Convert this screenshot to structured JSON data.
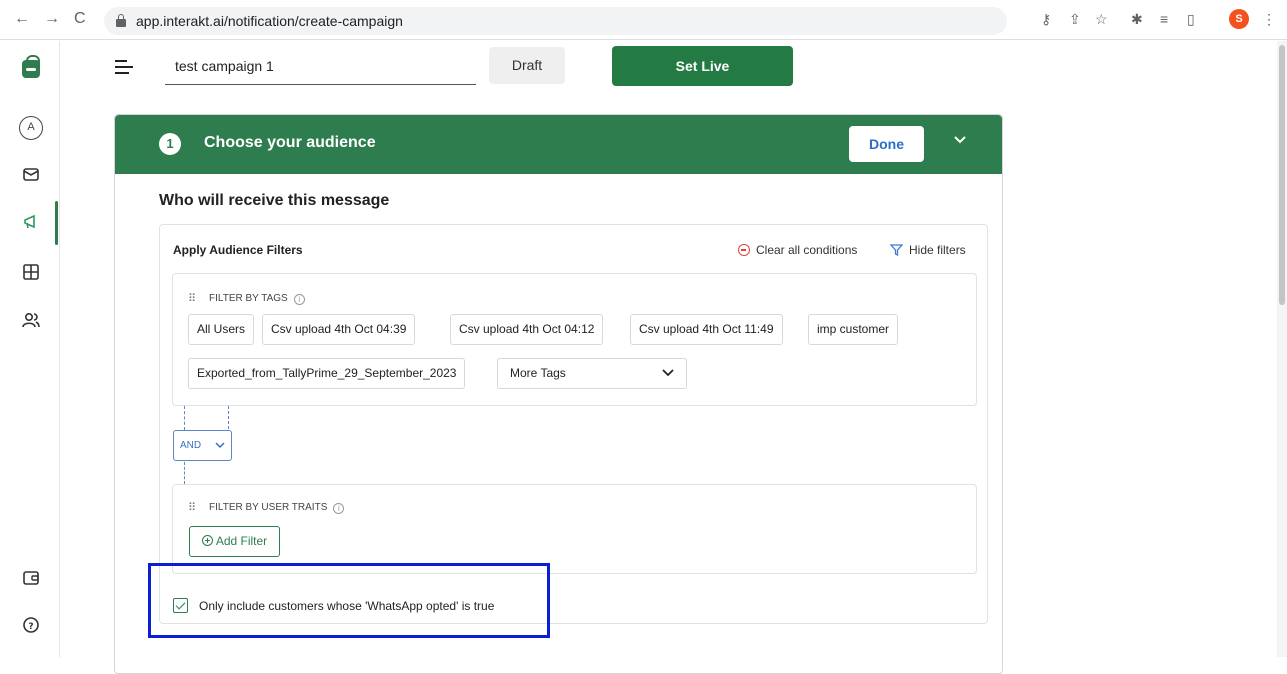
{
  "browser": {
    "url": "app.interakt.ai/notification/create-campaign",
    "profile_initial": "S"
  },
  "topbar": {
    "campaign_name": "test campaign 1",
    "draft_label": "Draft",
    "set_live_label": "Set Live"
  },
  "section": {
    "step_number": "1",
    "title": "Choose your audience",
    "done_label": "Done",
    "subtitle": "Who will receive this message"
  },
  "filters": {
    "title": "Apply Audience Filters",
    "clear_all": "Clear all conditions",
    "hide_filters": "Hide filters",
    "tags_label": "FILTER BY TAGS",
    "tags": [
      "All Users",
      "Csv upload 4th Oct 04:39",
      "Csv upload 4th Oct 04:12",
      "Csv upload 4th Oct 11:49",
      "imp customer",
      "Exported_from_TallyPrime_29_September_2023"
    ],
    "more_tags": "More Tags",
    "operator": "AND",
    "traits_label": "FILTER BY USER TRAITS",
    "add_filter": "Add Filter",
    "optin_text": "Only include customers whose 'WhatsApp opted' is true"
  },
  "colors": {
    "brand_green": "#2e7d4f",
    "link_blue": "#2a6fc9",
    "highlight_blue": "#0a1ed6"
  }
}
